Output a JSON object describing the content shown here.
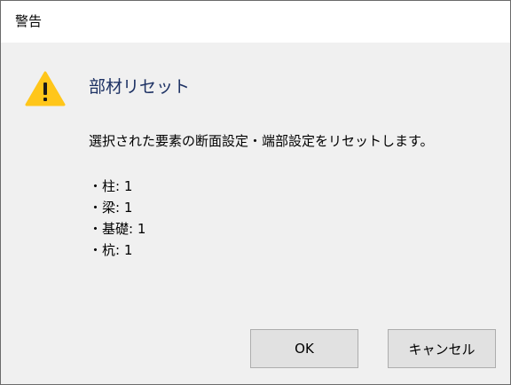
{
  "window": {
    "title": "警告"
  },
  "dialog": {
    "icon": "warning-icon",
    "heading": "部材リセット",
    "message": "選択された要素の断面設定・端部設定をリセットします。",
    "details": [
      "・柱: 1",
      "・梁: 1",
      "・基礎: 1",
      "・杭: 1"
    ]
  },
  "buttons": {
    "ok_label": "OK",
    "cancel_label": "キャンセル"
  },
  "colors": {
    "warning_yellow": "#FFC61A",
    "heading_blue": "#1E3264",
    "dialog_background": "#F0F0F0",
    "button_background": "#E1E1E1",
    "button_border": "#ADADAD"
  }
}
